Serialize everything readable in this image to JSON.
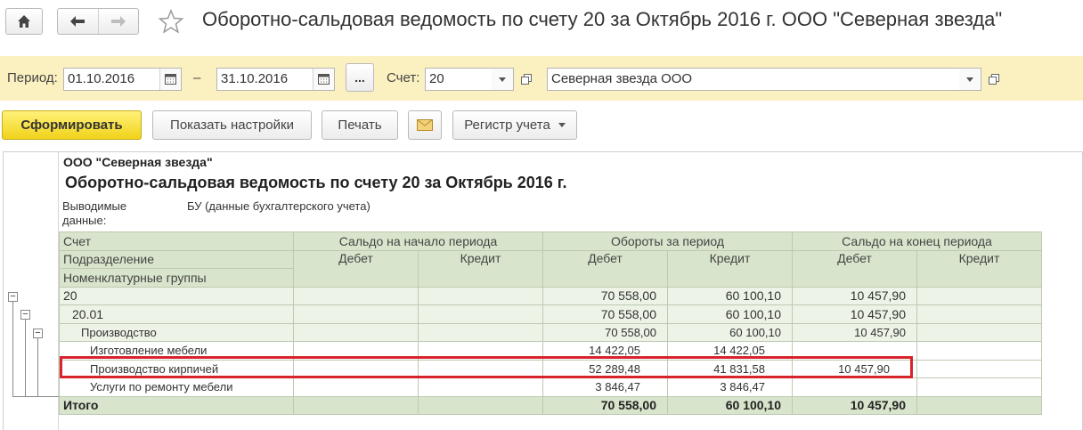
{
  "window": {
    "title": "Оборотно-сальдовая ведомость по счету 20 за Октябрь 2016 г. ООО \"Северная звезда\""
  },
  "params": {
    "period_label": "Период:",
    "date_from": "01.10.2016",
    "dash": "–",
    "date_to": "31.10.2016",
    "dots": "...",
    "account_label": "Счет:",
    "account": "20",
    "organization": "Северная звезда ООО"
  },
  "toolbar": {
    "generate": "Сформировать",
    "show_settings": "Показать настройки",
    "print": "Печать",
    "register": "Регистр учета"
  },
  "report": {
    "org": "ООО \"Северная звезда\"",
    "title": "Оборотно-сальдовая ведомость по счету 20 за Октябрь 2016 г.",
    "output_label": "Выводимые данные:",
    "output_value": "БУ (данные бухгалтерского учета)",
    "headers": {
      "account": "Счет",
      "subdivision": "Подразделение",
      "nomenclature": "Номенклатурные группы",
      "opening": "Сальдо на начало периода",
      "turnover": "Обороты за период",
      "closing": "Сальдо на конец периода",
      "debit": "Дебет",
      "credit": "Кредит"
    },
    "rows": [
      {
        "name": "20",
        "od": "",
        "oc": "",
        "td": "70 558,00",
        "tc": "60 100,10",
        "cd": "10 457,90",
        "cc": ""
      },
      {
        "name": "20.01",
        "od": "",
        "oc": "",
        "td": "70 558,00",
        "tc": "60 100,10",
        "cd": "10 457,90",
        "cc": ""
      },
      {
        "name": "Производство",
        "od": "",
        "oc": "",
        "td": "70 558,00",
        "tc": "60 100,10",
        "cd": "10 457,90",
        "cc": ""
      },
      {
        "name": "Изготовление мебели",
        "od": "",
        "oc": "",
        "td": "14 422,05",
        "tc": "14 422,05",
        "cd": "",
        "cc": ""
      },
      {
        "name": "Производство кирпичей",
        "od": "",
        "oc": "",
        "td": "52 289,48",
        "tc": "41 831,58",
        "cd": "10 457,90",
        "cc": ""
      },
      {
        "name": "Услуги по ремонту мебели",
        "od": "",
        "oc": "",
        "td": "3 846,47",
        "tc": "3 846,47",
        "cd": "",
        "cc": ""
      }
    ],
    "total": {
      "name": "Итого",
      "td": "70 558,00",
      "tc": "60 100,10",
      "cd": "10 457,90"
    }
  },
  "colors": {
    "accent_yellow": "#f1d219",
    "panel_yellow": "#fbf0c0",
    "grid_green": "#d8e5cc",
    "highlight_red": "#d9232b"
  }
}
